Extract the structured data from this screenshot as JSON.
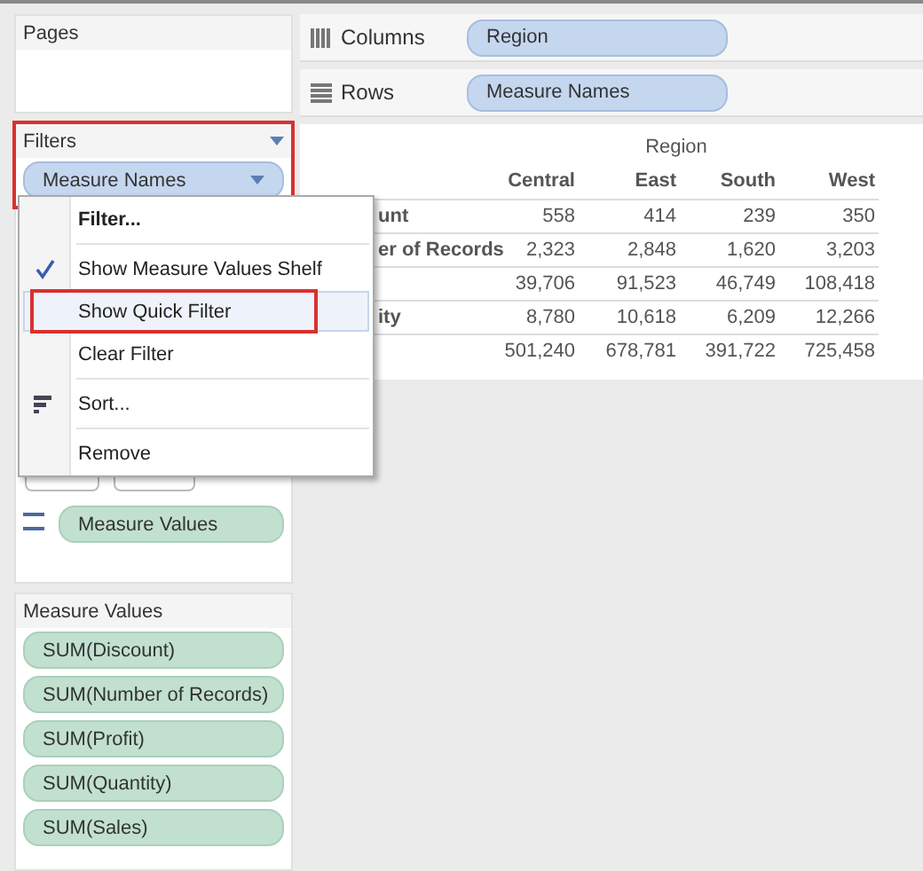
{
  "pages": {
    "title": "Pages"
  },
  "filters": {
    "title": "Filters",
    "outlined": true,
    "pill": "Measure Names"
  },
  "context_menu": {
    "groups": [
      [
        {
          "label": "Filter...",
          "kind": "default",
          "checked": false,
          "selected": false,
          "outlined": false
        }
      ],
      [
        {
          "label": "Show Measure Values Shelf",
          "kind": "plain",
          "checked": true,
          "selected": false,
          "outlined": false
        },
        {
          "label": "Show Quick Filter",
          "kind": "plain",
          "checked": false,
          "selected": true,
          "outlined": true
        },
        {
          "label": "Clear Filter",
          "kind": "plain",
          "checked": false,
          "selected": false,
          "outlined": false
        }
      ],
      [
        {
          "label": "Sort...",
          "kind": "sort",
          "checked": false,
          "selected": false,
          "outlined": false
        }
      ],
      [
        {
          "label": "Remove",
          "kind": "plain",
          "checked": false,
          "selected": false,
          "outlined": false
        }
      ]
    ]
  },
  "marks": {
    "pill": "Measure Values"
  },
  "measure_values": {
    "title": "Measure Values",
    "pills": [
      "SUM(Discount)",
      "SUM(Number of Records)",
      "SUM(Profit)",
      "SUM(Quantity)",
      "SUM(Sales)"
    ]
  },
  "columns_shelf": {
    "label": "Columns",
    "pill": "Region"
  },
  "rows_shelf": {
    "label": "Rows",
    "pill": "Measure Names"
  },
  "table": {
    "header": "Region",
    "columns": [
      "Central",
      "East",
      "South",
      "West"
    ],
    "rows": [
      {
        "label": "unt",
        "values": [
          "558",
          "414",
          "239",
          "350"
        ]
      },
      {
        "label": "er of Records",
        "values": [
          "2,323",
          "2,848",
          "1,620",
          "3,203"
        ]
      },
      {
        "values": [
          "39,706",
          "91,523",
          "46,749",
          "108,418"
        ]
      },
      {
        "label": "ity",
        "values": [
          "8,780",
          "10,618",
          "6,209",
          "12,266"
        ]
      },
      {
        "values": [
          "501,240",
          "678,781",
          "391,722",
          "725,458"
        ]
      }
    ]
  }
}
